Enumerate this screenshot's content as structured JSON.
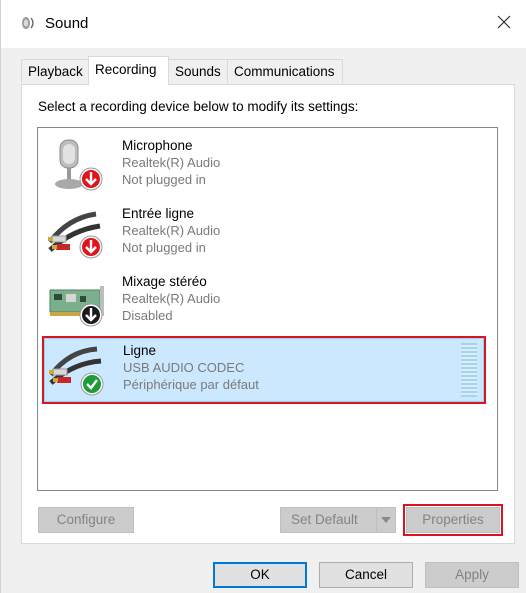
{
  "window": {
    "title": "Sound",
    "title_icon": "speaker-icon",
    "close_icon": "close-icon"
  },
  "tabs": [
    {
      "label": "Playback",
      "active": false
    },
    {
      "label": "Recording",
      "active": true
    },
    {
      "label": "Sounds",
      "active": false
    },
    {
      "label": "Communications",
      "active": false
    }
  ],
  "panel": {
    "instruction": "Select a recording device below to modify its settings:"
  },
  "devices": [
    {
      "name": "Microphone",
      "driver": "Realtek(R) Audio",
      "status": "Not plugged in",
      "icon": "microphone-icon",
      "badge": "red-down-arrow-icon",
      "selected": false
    },
    {
      "name": "Entrée ligne",
      "driver": "Realtek(R) Audio",
      "status": "Not plugged in",
      "icon": "line-in-cable-icon",
      "badge": "red-down-arrow-icon",
      "selected": false
    },
    {
      "name": "Mixage stéréo",
      "driver": "Realtek(R) Audio",
      "status": "Disabled",
      "icon": "sound-card-icon",
      "badge": "black-down-arrow-icon",
      "selected": false
    },
    {
      "name": "Ligne",
      "driver": "USB AUDIO  CODEC",
      "status": "Périphérique par défaut",
      "icon": "line-in-cable-icon",
      "badge": "green-check-icon",
      "selected": true
    }
  ],
  "buttons": {
    "configure": "Configure",
    "set_default": "Set Default",
    "properties": "Properties",
    "ok": "OK",
    "cancel": "Cancel",
    "apply": "Apply"
  },
  "colors": {
    "selection_bg": "#cce8ff",
    "highlight_border": "#d9131f",
    "primary_button_border": "#0078d7"
  }
}
